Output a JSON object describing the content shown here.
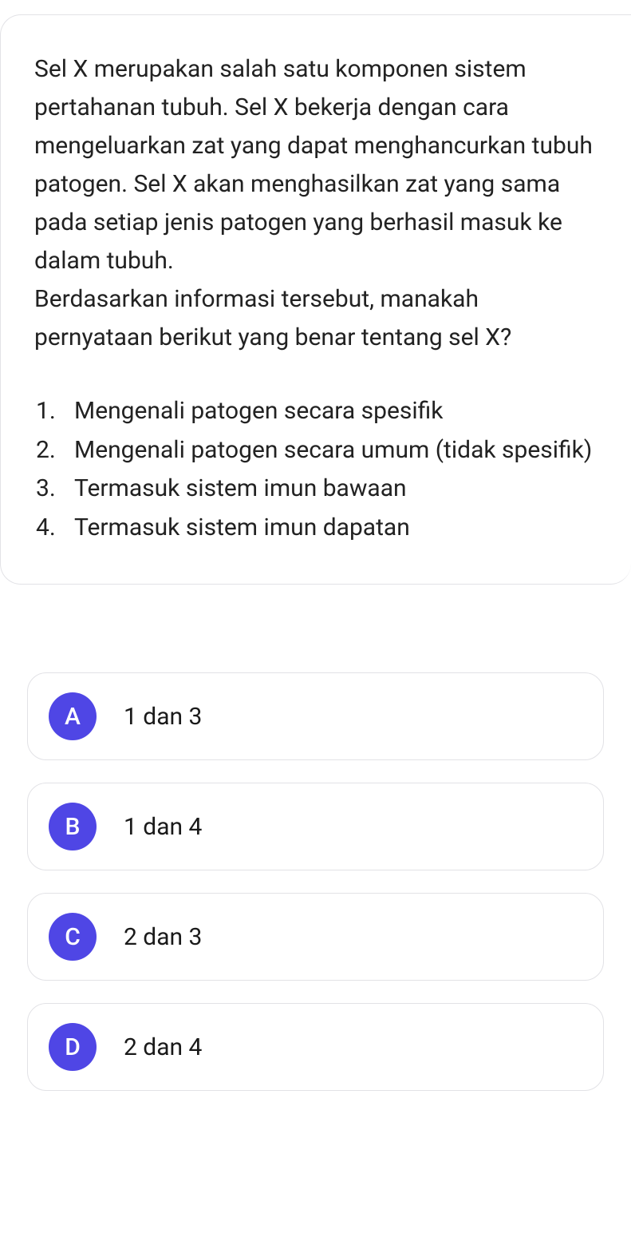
{
  "question": {
    "paragraph1": "Sel X merupakan salah satu komponen sistem pertahanan tubuh. Sel X bekerja dengan cara mengeluarkan zat yang dapat menghancurkan tubuh patogen. Sel X akan menghasilkan zat yang sama pada setiap jenis patogen yang berhasil masuk ke dalam tubuh.",
    "paragraph2": "Berdasarkan informasi tersebut, manakah pernyataan berikut yang benar tentang sel X?",
    "statements": [
      "Mengenali patogen secara spesifik",
      "Mengenali patogen secara umum (tidak spesifik)",
      "Termasuk sistem imun bawaan",
      "Termasuk sistem imun dapatan"
    ]
  },
  "options": [
    {
      "letter": "A",
      "text": "1 dan 3"
    },
    {
      "letter": "B",
      "text": "1 dan 4"
    },
    {
      "letter": "C",
      "text": "2 dan 3"
    },
    {
      "letter": "D",
      "text": "2 dan 4"
    }
  ]
}
